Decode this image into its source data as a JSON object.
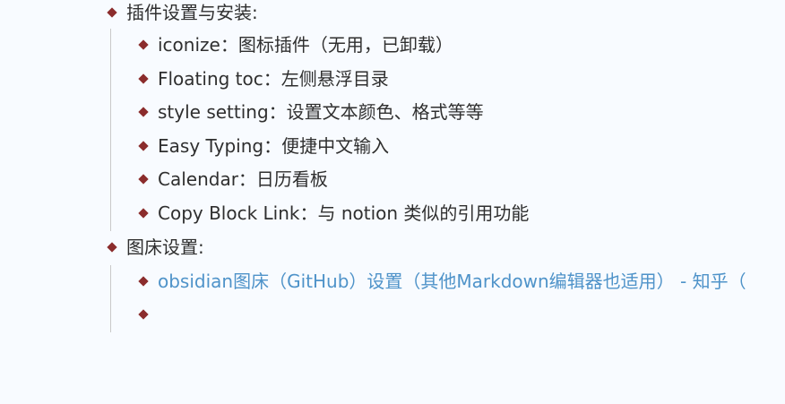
{
  "outline": {
    "section_plugins": {
      "title": "插件设置与安装:",
      "items": [
        "iconize：图标插件（无用，已卸载）",
        "Floating toc：左侧悬浮目录",
        "style setting：设置文本颜色、格式等等",
        "Easy Typing：便捷中文输入",
        "Calendar：日历看板",
        "Copy Block Link：与 notion 类似的引用功能"
      ]
    },
    "section_image_host": {
      "title": "图床设置:",
      "items": [
        "obsidian图床（GitHub）设置（其他Markdown编辑器也适用） - 知乎（",
        ""
      ]
    }
  },
  "icons": {
    "bullet": "diamond-bullet-icon"
  },
  "colors": {
    "background": "#f8fbff",
    "bullet": "#8b2c2c",
    "link": "#4f93c9",
    "guide_line": "#c9c9c9"
  }
}
